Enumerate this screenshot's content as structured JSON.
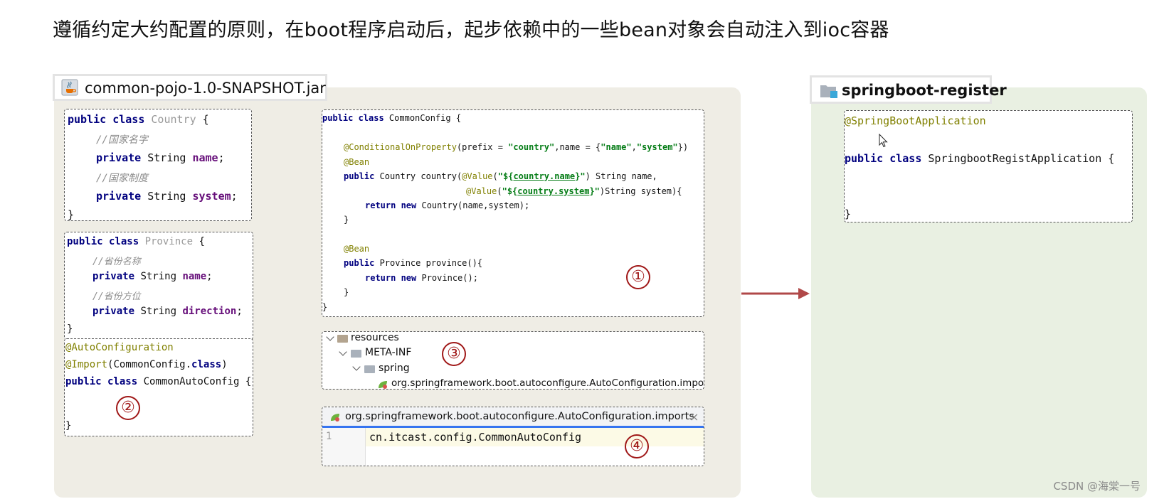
{
  "heading": "遵循约定大约配置的原则，在boot程序启动后，起步依赖中的一些bean对象会自动注入到ioc容器",
  "left_panel": {
    "tab_label": "common-pojo-1.0-SNAPSHOT.jar",
    "tab_icon": "java-jar-icon",
    "country_class": {
      "l1_kw": "public class ",
      "l1_name": "Country",
      "l1_end": " {",
      "l2": "//国家名字",
      "l3_kw": "private ",
      "l3_type": "String ",
      "l3_field": "name",
      "l3_end": ";",
      "l4": "//国家制度",
      "l5_kw": "private ",
      "l5_type": "String ",
      "l5_field": "system",
      "l5_end": ";",
      "l6": "}"
    },
    "province_class": {
      "l1_kw": "public class ",
      "l1_name": "Province",
      "l1_end": " {",
      "l2": "//省份名称",
      "l3_kw": "private ",
      "l3_type": "String ",
      "l3_field": "name",
      "l3_end": ";",
      "l4": "//省份方位",
      "l5_kw": "private ",
      "l5_type": "String ",
      "l5_field": "direction",
      "l5_end": ";",
      "l6": "}"
    },
    "auto_config": {
      "l1": "@AutoConfiguration",
      "l2_an": "@Import",
      "l2_rest1": "(CommonConfig.",
      "l2_kw": "class",
      "l2_rest2": ")",
      "l3_kw": "public class ",
      "l3_rest": "CommonAutoConfig {",
      "l4": "}",
      "marker": "②"
    },
    "common_config": {
      "l1_kw": "public class ",
      "l1_rest": "CommonConfig {",
      "l2_an": "@ConditionalOnProperty",
      "l2_a": "(prefix = ",
      "l2_s1": "\"country\"",
      "l2_b": ",name = {",
      "l2_s2": "\"name\"",
      "l2_c": ",",
      "l2_s3": "\"system\"",
      "l2_d": "})",
      "l3": "@Bean",
      "l4_kw": "public ",
      "l4_a": "Country country(",
      "l4_an": "@Value",
      "l4_b": "(",
      "l4_s_open": "\"${",
      "l4_s_mid": "country.name",
      "l4_s_close": "}\"",
      "l4_c": ") String name,",
      "l5_an": "@Value",
      "l5_b": "(",
      "l5_s_open": "\"${",
      "l5_s_mid": "country.system",
      "l5_s_close": "}\"",
      "l5_c": ")String system){",
      "l6_kw": "return new ",
      "l6_rest": "Country(name,system);",
      "l7": "}",
      "l8": "@Bean",
      "l9_kw": "public ",
      "l9_rest": "Province province(){",
      "l10_kw": "return new ",
      "l10_rest": "Province();",
      "l11": "}",
      "l12": "}",
      "marker": "①"
    },
    "resources_tree": {
      "root": "resources",
      "meta_inf": "META-INF",
      "spring": "spring",
      "file": "org.springframework.boot.autoconfigure.AutoConfiguration.imports",
      "marker": "③"
    },
    "imports_file": {
      "tab_title": "org.springframework.boot.autoconfigure.AutoConfiguration.imports",
      "close": "×",
      "line_number": "1",
      "line_content": "cn.itcast.config.CommonAutoConfig",
      "marker": "④"
    }
  },
  "right_panel": {
    "tab_label": "springboot-register",
    "tab_icon": "module-folder-icon",
    "app_class": {
      "l1": "@SpringBootApplication",
      "l2_kw": "public class ",
      "l2_rest": "SpringbootRegistApplication {",
      "l3": "}"
    }
  },
  "arrow": {
    "color": "#b04848"
  },
  "colors": {
    "left_panel_bg": "#efede5",
    "right_panel_bg": "#e9f0e2",
    "keyword": "#00007f",
    "annotation": "#808000",
    "string": "#067d17",
    "field": "#660e7a",
    "marker": "#a01818"
  },
  "watermark": "CSDN @海棠一号"
}
